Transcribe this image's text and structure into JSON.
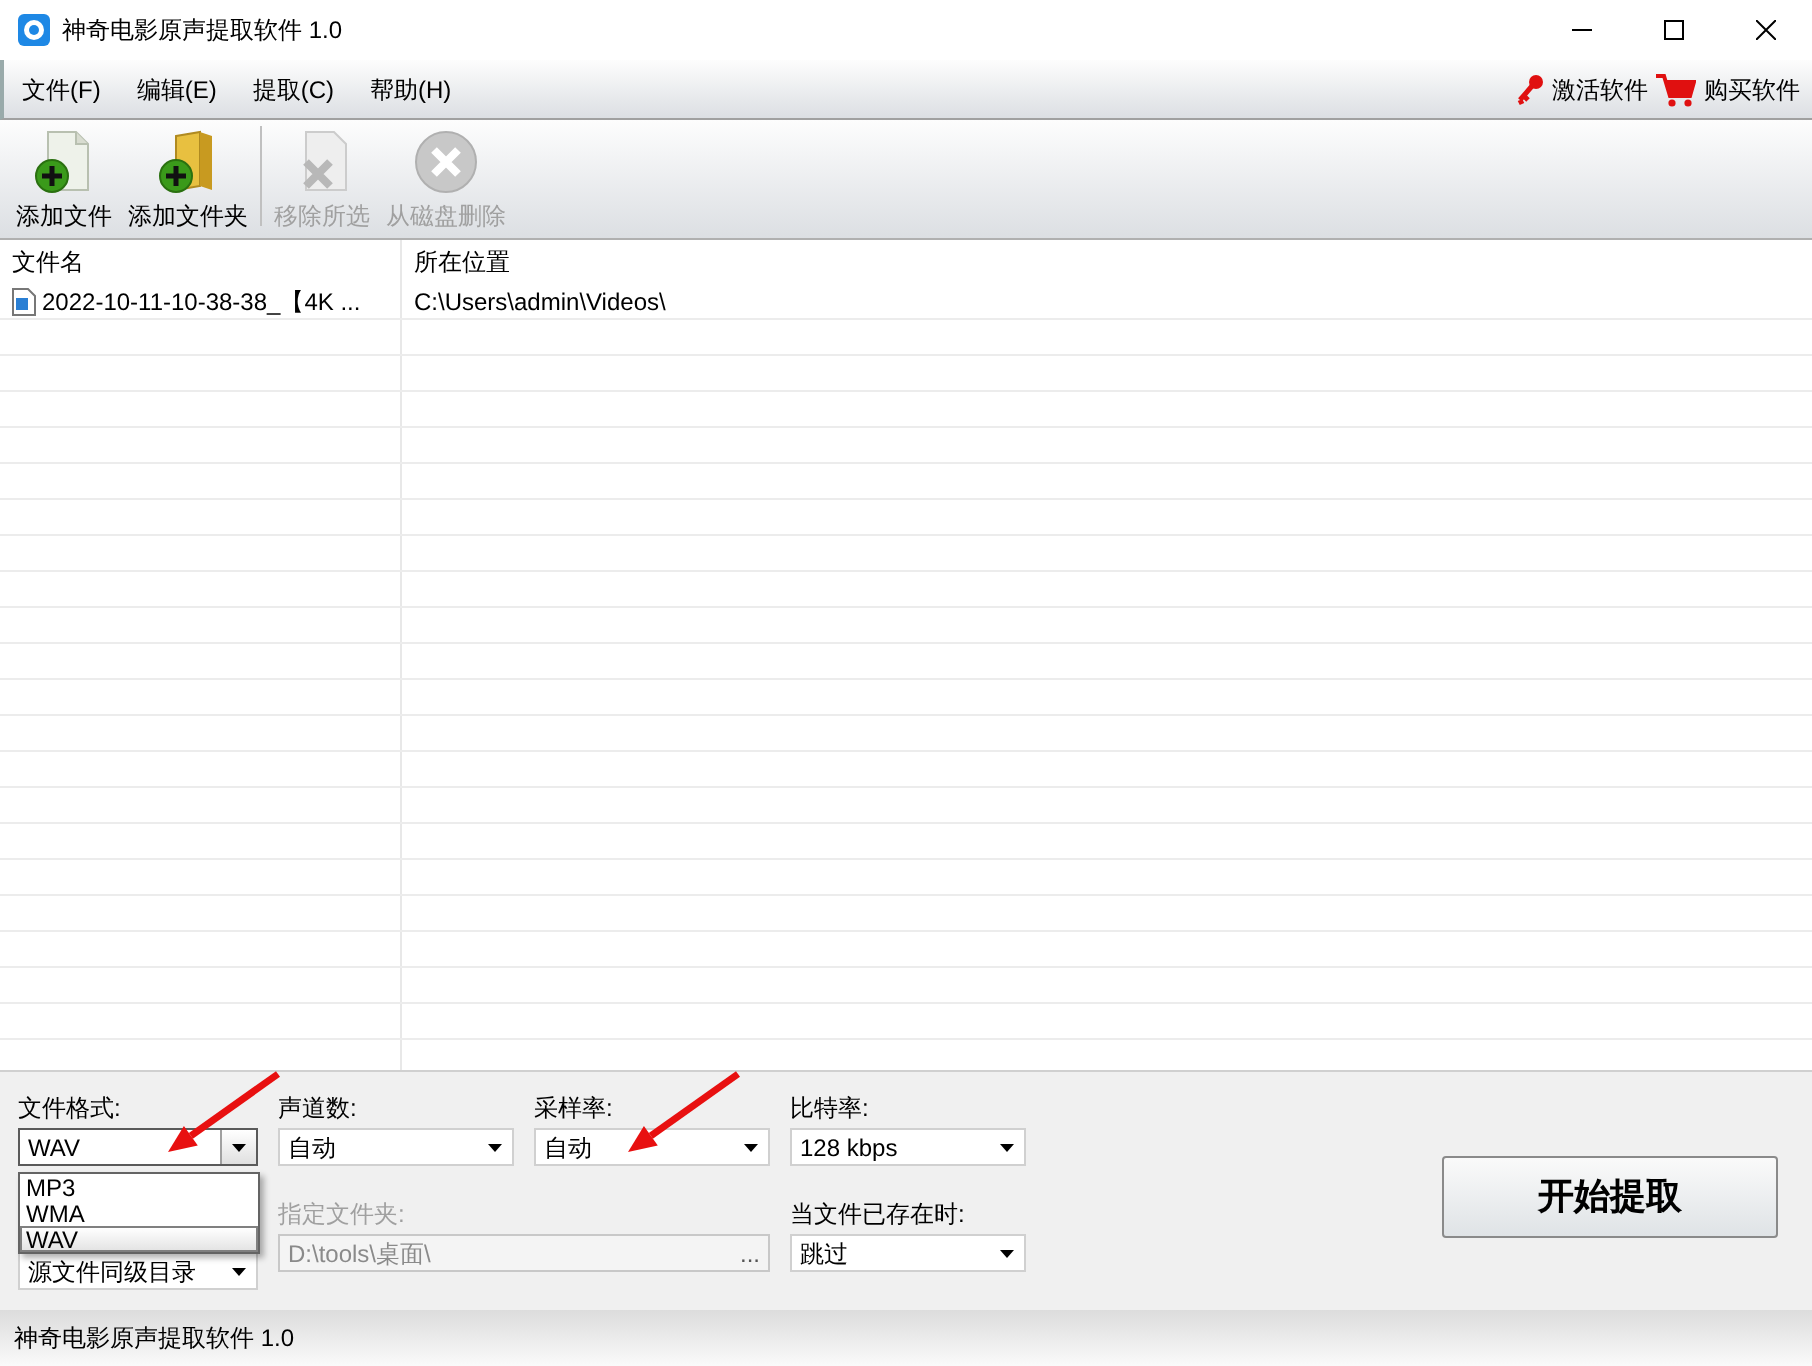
{
  "window": {
    "title": "神奇电影原声提取软件 1.0"
  },
  "menu": [
    {
      "label": "文件(F)"
    },
    {
      "label": "编辑(E)"
    },
    {
      "label": "提取(C)"
    },
    {
      "label": "帮助(H)"
    }
  ],
  "menu_links": [
    {
      "kind": "key",
      "label": "激活软件"
    },
    {
      "kind": "cart",
      "label": "购买软件"
    }
  ],
  "toolbar": [
    {
      "kind": "add-file",
      "label": "添加文件",
      "disabled": false
    },
    {
      "kind": "add-folder",
      "label": "添加文件夹",
      "disabled": false
    },
    {
      "kind": "remove",
      "label": "移除所选",
      "disabled": true
    },
    {
      "kind": "delete",
      "label": "从磁盘删除",
      "disabled": true
    }
  ],
  "table": {
    "columns": [
      "文件名",
      "所在位置"
    ],
    "rows": [
      {
        "name": "2022-10-11-10-38-38_【4K ...",
        "location": "C:\\Users\\admin\\Videos\\"
      }
    ]
  },
  "options": {
    "format": {
      "label": "文件格式:",
      "value": "WAV",
      "expanded": true,
      "options": [
        {
          "label": "MP3",
          "selected": false
        },
        {
          "label": "WMA",
          "selected": false
        },
        {
          "label": "WAV",
          "selected": true
        }
      ]
    },
    "channels": {
      "label": "声道数:",
      "value": "自动"
    },
    "sample_rate": {
      "label": "采样率:",
      "value": "自动"
    },
    "bitrate": {
      "label": "比特率:",
      "value": "128 kbps"
    },
    "output_dir": {
      "value": "源文件同级目录"
    },
    "folder": {
      "label": "指定文件夹:",
      "value": "D:\\tools\\桌面\\",
      "disabled": true,
      "browse": "..."
    },
    "exists": {
      "label": "当文件已存在时:",
      "value": "跳过"
    },
    "start_button": "开始提取"
  },
  "status_bar": "神奇电影原声提取软件 1.0"
}
